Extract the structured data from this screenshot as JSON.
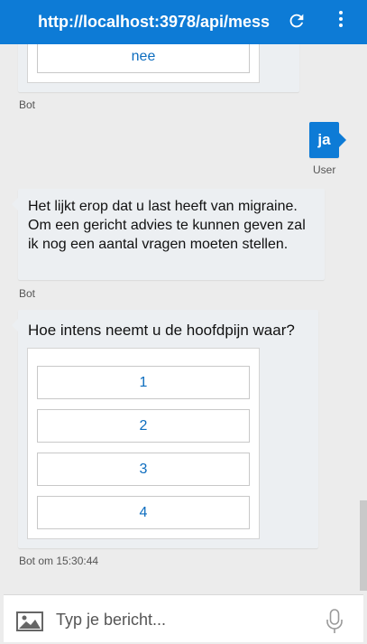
{
  "topbar": {
    "url": "http://localhost:3978/api/mess"
  },
  "messages": {
    "prev_choice": "nee",
    "prev_sender": "Bot",
    "user_text": "ja",
    "user_sender": "User",
    "bot_text": "Het lijkt erop dat u last heeft van migraine. Om een gericht advies te kunnen geven zal ik nog een aantal vragen moeten stellen.",
    "bot_sender": "Bot",
    "question": "Hoe intens neemt u de hoofdpijn waar?",
    "choices": [
      "1",
      "2",
      "3",
      "4"
    ],
    "question_meta": "Bot om 15:30:44"
  },
  "composer": {
    "placeholder": "Typ je bericht..."
  }
}
